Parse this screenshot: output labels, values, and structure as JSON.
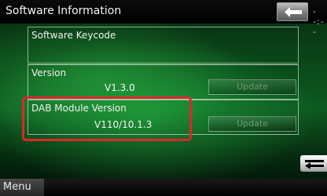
{
  "header": {
    "title": "Software Information",
    "clock": "--:--",
    "back_icon": "back-arrow-icon"
  },
  "panels": {
    "keycode": {
      "label": "Software Keycode",
      "value": ""
    },
    "version": {
      "label": "Version",
      "value": "V1.3.0",
      "button": "Update"
    },
    "dab": {
      "label": "DAB Module Version",
      "value": "V110/10.1.3",
      "button": "Update"
    }
  },
  "footer": {
    "menu_label": "Menu",
    "return_icon": "return-icon"
  },
  "colors": {
    "highlight": "#e0262b",
    "background_green": "#0d5a20"
  }
}
